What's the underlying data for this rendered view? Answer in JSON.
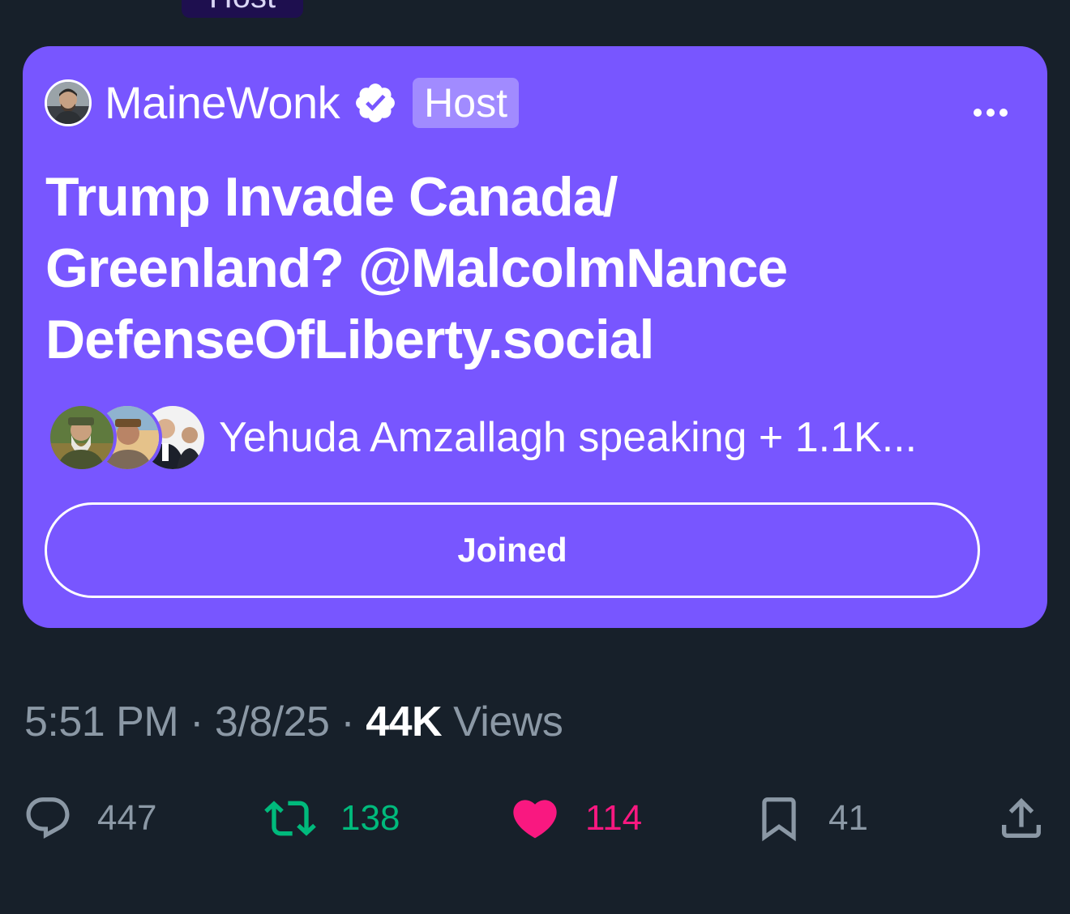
{
  "top_host_tag": "Host",
  "space": {
    "host_name": "MaineWonk",
    "host_badge": "Host",
    "title_lines": [
      "Trump Invade Canada/",
      "Greenland? @MalcolmNance",
      "DefenseOfLiberty.social"
    ],
    "speakers_text": "Yehuda Amzallagh speaking + 1.1K...",
    "joined_label": "Joined",
    "card_color": "#7856ff"
  },
  "meta": {
    "time": "5:51 PM",
    "sep1": "·",
    "date": "3/8/25",
    "sep2": "·",
    "views_count": "44K",
    "views_label": "Views"
  },
  "actions": {
    "reply": {
      "icon": "reply-icon",
      "count": "447",
      "color": "#8b98a5"
    },
    "repost": {
      "icon": "repost-icon",
      "count": "138",
      "color": "#00ba7c"
    },
    "like": {
      "icon": "heart-icon",
      "count": "114",
      "color": "#f91880"
    },
    "bookmark": {
      "icon": "bookmark-icon",
      "count": "41",
      "color": "#8b98a5"
    },
    "share": {
      "icon": "share-icon",
      "color": "#8b98a5"
    }
  }
}
